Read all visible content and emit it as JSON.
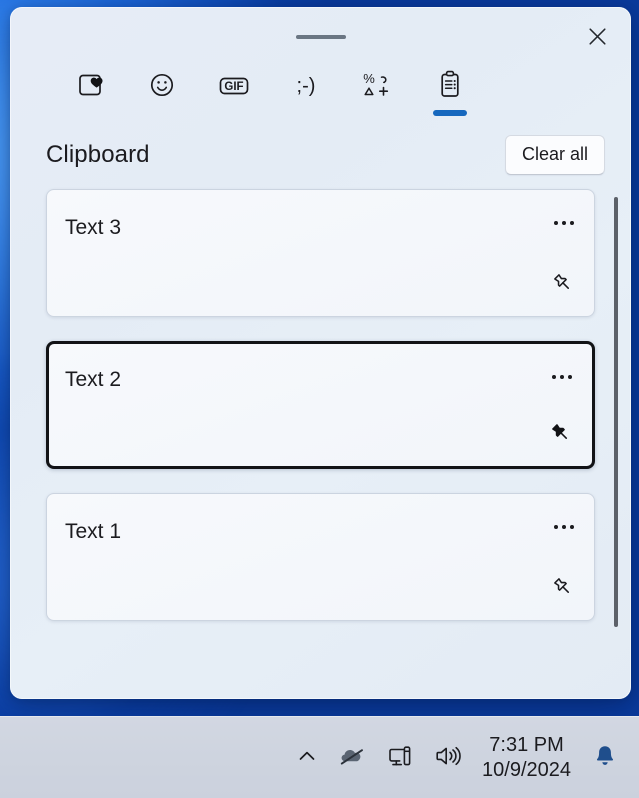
{
  "panel": {
    "title": "Clipboard",
    "clear_all_label": "Clear all",
    "close_icon": "close-icon",
    "drag_handle_icon": "drag-handle",
    "accent_color": "#1668be",
    "selection_border_color": "#121316"
  },
  "tabs": [
    {
      "icon": "recent-favorites-heart-icon",
      "name": "tab-recent",
      "active": false
    },
    {
      "icon": "emoji-smiley-icon",
      "name": "tab-emoji",
      "active": false
    },
    {
      "icon": "gif-icon",
      "name": "tab-gif",
      "label": "GIF",
      "active": false
    },
    {
      "icon": "kaomoji-icon",
      "name": "tab-kaomoji",
      "label": ";-)",
      "active": false
    },
    {
      "icon": "symbols-icon",
      "name": "tab-symbols",
      "active": false
    },
    {
      "icon": "clipboard-icon",
      "name": "tab-clipboard",
      "active": true
    }
  ],
  "clipboard_items": [
    {
      "text": "Text 3",
      "pinned": false,
      "selected": false,
      "pin_icon": "pin-outline-icon",
      "more_icon": "more-options-icon"
    },
    {
      "text": "Text 2",
      "pinned": true,
      "selected": true,
      "pin_icon": "pin-filled-icon",
      "more_icon": "more-options-icon"
    },
    {
      "text": "Text 1",
      "pinned": false,
      "selected": false,
      "pin_icon": "pin-outline-icon",
      "more_icon": "more-options-icon"
    }
  ],
  "taskbar": {
    "chevron_icon": "chevron-up-icon",
    "onedrive_icon": "onedrive-offline-icon",
    "network_icon": "network-monitor-icon",
    "volume_icon": "speaker-volume-icon",
    "clock_time": "7:31 PM",
    "clock_date": "10/9/2024",
    "notification_icon": "notification-bell-icon",
    "notification_color": "#1f4e8c"
  }
}
